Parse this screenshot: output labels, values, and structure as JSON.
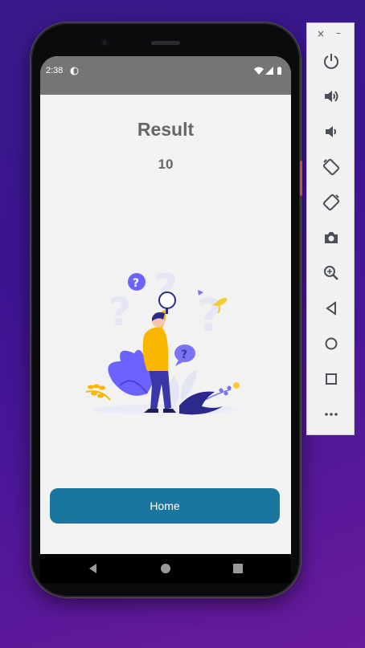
{
  "status_bar": {
    "time": "2:38"
  },
  "screen": {
    "title": "Result",
    "score": "10",
    "home_button_label": "Home"
  },
  "colors": {
    "button": "#1a769f",
    "accent_purple": "#6c63ff",
    "accent_yellow": "#f9b700"
  },
  "nav_bar": {
    "icons": [
      "back-triangle-icon",
      "home-circle-icon",
      "recents-square-icon"
    ]
  },
  "emulator_panel": {
    "window_controls": [
      "close-icon",
      "minimize-icon"
    ],
    "tools": [
      "power-icon",
      "volume-up-icon",
      "volume-down-icon",
      "rotate-left-icon",
      "rotate-right-icon",
      "camera-icon",
      "zoom-icon",
      "back-icon",
      "home-icon",
      "overview-icon",
      "more-icon"
    ],
    "close_glyph": "×",
    "minimize_glyph": "–"
  }
}
